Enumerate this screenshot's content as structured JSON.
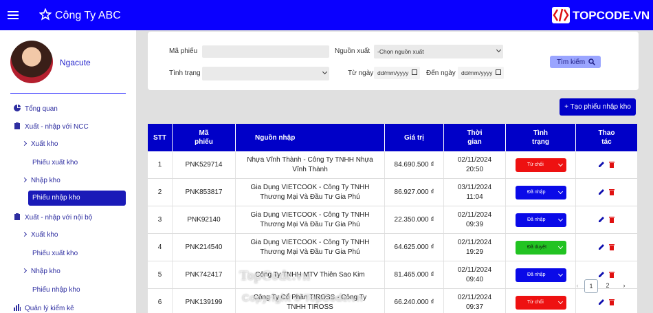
{
  "header": {
    "brand": "Công Ty ABC",
    "logo_text": "TOPCODE.VN",
    "accent": "#0a00ff"
  },
  "sidebar": {
    "user_name": "Ngacute",
    "items": [
      {
        "label": "Tổng quan",
        "icon": "pie-chart-icon"
      },
      {
        "label": "Xuất - nhập với NCC",
        "icon": "clipboard-icon"
      },
      {
        "label": "Xuất kho",
        "icon": "chevron-right-icon"
      },
      {
        "label": "Phiếu xuất kho"
      },
      {
        "label": "Nhập kho",
        "icon": "chevron-right-icon"
      },
      {
        "label": "Phiếu nhập kho",
        "active": true
      },
      {
        "label": "Xuất - nhập với nội bộ",
        "icon": "clipboard-icon"
      },
      {
        "label": "Xuất kho",
        "icon": "chevron-right-icon"
      },
      {
        "label": "Phiếu xuất kho"
      },
      {
        "label": "Nhập kho",
        "icon": "chevron-right-icon"
      },
      {
        "label": "Phiếu nhập kho"
      },
      {
        "label": "Quản lý kiểm kê",
        "icon": "bar-chart-icon"
      }
    ]
  },
  "filters": {
    "code_label": "Mã phiếu",
    "code_value": "",
    "source_label": "Nguồn xuất",
    "source_value": "-Chọn nguồn xuất",
    "status_label": "Tình trạng",
    "status_value": "",
    "from_label": "Từ ngày",
    "from_value": "dd/mm/yyyy",
    "to_label": "Đến ngày",
    "to_value": "dd/mm/yyyy",
    "search_label": "Tìm kiếm"
  },
  "add_button": "+ Tạo phiếu nhập kho",
  "table": {
    "headers": [
      "STT",
      "Mã phiếu",
      "Nguồn nhập",
      "Giá trị",
      "Thời gian",
      "Tình trạng",
      "Thao tác"
    ],
    "rows": [
      {
        "stt": "1",
        "code": "PNK529714",
        "source": "Nhựa Vĩnh Thành - Công Ty TNHH Nhựa Vĩnh Thành",
        "value": "84.690.500 ₫",
        "date": "02/11/2024",
        "time": "20:50",
        "status": "Từ chối",
        "status_color": "#ee1111"
      },
      {
        "stt": "2",
        "code": "PNK853817",
        "source": "Gia Dụng VIETCOOK - Công Ty TNHH Thương Mại Và Đầu Tư Gia Phú",
        "value": "86.927.000 ₫",
        "date": "03/11/2024",
        "time": "11:04",
        "status": "Đã nhập",
        "status_color": "#0a0ae8"
      },
      {
        "stt": "3",
        "code": "PNK92140",
        "source": "Gia Dụng VIETCOOK - Công Ty TNHH Thương Mại Và Đầu Tư Gia Phú",
        "value": "22.350.000 ₫",
        "date": "02/11/2024",
        "time": "09:39",
        "status": "Đã nhập",
        "status_color": "#0a0ae8"
      },
      {
        "stt": "4",
        "code": "PNK214540",
        "source": "Gia Dụng VIETCOOK - Công Ty TNHH Thương Mại Và Đầu Tư Gia Phú",
        "value": "64.625.000 ₫",
        "date": "02/11/2024",
        "time": "19:29",
        "status": "Đã duyệt",
        "status_color": "#22c322"
      },
      {
        "stt": "5",
        "code": "PNK742417",
        "source": "Công Ty TNHH MTV Thiên Sao Kim",
        "value": "81.465.000 ₫",
        "date": "02/11/2024",
        "time": "09:40",
        "status": "Đã nhập",
        "status_color": "#0a0ae8"
      },
      {
        "stt": "6",
        "code": "PNK139199",
        "source": "Công Ty Cổ Phần TIROSS - Công Ty TNHH TIROSS",
        "value": "66.240.000 ₫",
        "date": "02/11/2024",
        "time": "09:37",
        "status": "Từ chối",
        "status_color": "#ee1111"
      }
    ]
  },
  "pagination": {
    "prev": "‹",
    "pages": [
      "1",
      "2"
    ],
    "next": "›",
    "current": "1"
  },
  "watermark": {
    "text1": "TopCode.vn",
    "text2": "Copyright © TopCode.vn"
  }
}
